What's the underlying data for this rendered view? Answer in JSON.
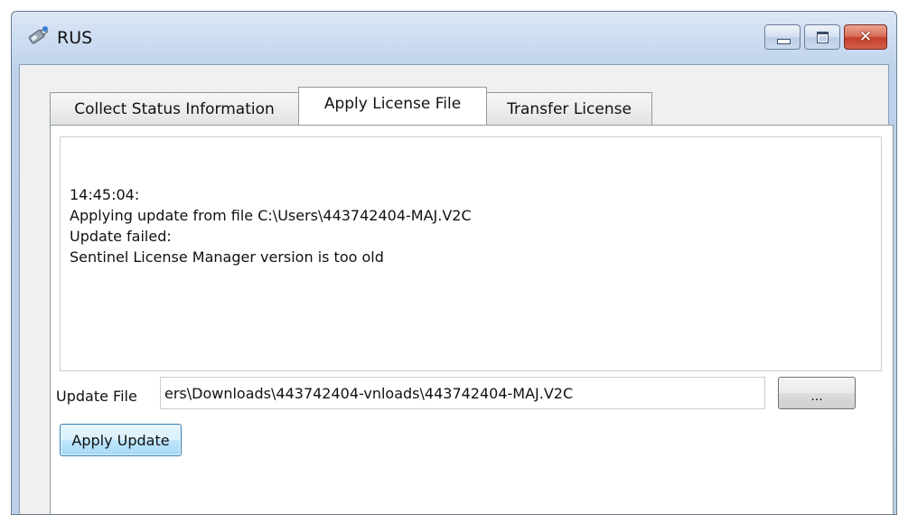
{
  "window": {
    "title": "RUS"
  },
  "tabs": [
    {
      "label": "Collect Status Information",
      "selected": false
    },
    {
      "label": "Apply License File",
      "selected": true
    },
    {
      "label": "Transfer License",
      "selected": false
    }
  ],
  "log": {
    "lines": [
      "14:45:04:",
      "Applying update from file C:\\Users\\443742404-MAJ.V2C",
      "Update failed:",
      "Sentinel License Manager version is too old"
    ]
  },
  "update_file": {
    "label": "Update File",
    "value": "ers\\Downloads\\443742404-vnloads\\443742404-MAJ.V2C"
  },
  "buttons": {
    "browse_label": "...",
    "apply_update_label": "Apply Update"
  },
  "icons": {
    "app": "usb-key-icon",
    "minimize": "minimize-icon",
    "maximize": "maximize-icon",
    "close": "close-icon"
  },
  "colors": {
    "titlebar": "#c9daf0",
    "close_button": "#c4402a",
    "apply_button_border": "#3c7fb1"
  }
}
